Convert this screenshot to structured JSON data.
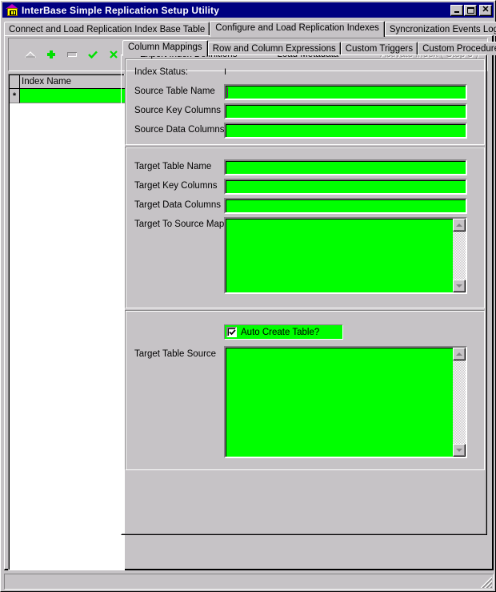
{
  "window": {
    "title": "InterBase Simple Replication Setup Utility",
    "app_icon": "building-icon",
    "controls": [
      "minimize-icon",
      "maximize-icon",
      "close-icon"
    ]
  },
  "main_tabs": [
    {
      "label": "Connect and Load Replication Index Base Table",
      "active": false
    },
    {
      "label": "Configure and Load Replication Indexes",
      "active": true
    },
    {
      "label": "Syncronization Events Log",
      "active": false
    }
  ],
  "toolbar": {
    "icons": [
      {
        "name": "move-up-icon",
        "enabled": false
      },
      {
        "name": "add-icon",
        "enabled": true
      },
      {
        "name": "delete-icon",
        "enabled": false
      },
      {
        "name": "confirm-icon",
        "enabled": true
      },
      {
        "name": "cancel-icon",
        "enabled": true
      }
    ],
    "export_label": "Export Index Definitions",
    "load_label": "Load Metadata",
    "activate_label": "Activate Index ( Step 3 )",
    "activate_enabled": false
  },
  "grid": {
    "columns": [
      "Index Name"
    ],
    "rows": [
      {
        "indicator": "*",
        "index_name": ""
      }
    ]
  },
  "sub_tabs": [
    {
      "label": "Column Mappings",
      "active": true
    },
    {
      "label": "Row and Column Expressions",
      "active": false
    },
    {
      "label": "Custom Triggers",
      "active": false
    },
    {
      "label": "Custom Procedures",
      "active": false
    }
  ],
  "source_group": {
    "index_status_label": "Index Status:",
    "index_status_value": "I",
    "source_table_name_label": "Source Table Name",
    "source_table_name_value": "",
    "source_key_columns_label": "Source Key Columns",
    "source_key_columns_value": "",
    "source_data_columns_label": "Source Data Columns",
    "source_data_columns_value": ""
  },
  "target_group": {
    "target_table_name_label": "Target Table Name",
    "target_table_name_value": "",
    "target_key_columns_label": "Target Key Columns",
    "target_key_columns_value": "",
    "target_data_columns_label": "Target Data Columns",
    "target_data_columns_value": "",
    "target_to_source_map_label": "Target To Source Map",
    "target_to_source_map_value": ""
  },
  "create_group": {
    "auto_create_label": "Auto Create Table?",
    "auto_create_checked": true,
    "target_table_source_label": "Target Table Source",
    "target_table_source_value": ""
  },
  "colors": {
    "field_bg": "#00ff00",
    "title_bar": "#000080",
    "window_bg": "#c6c3c6",
    "accent_green": "#00e000"
  }
}
